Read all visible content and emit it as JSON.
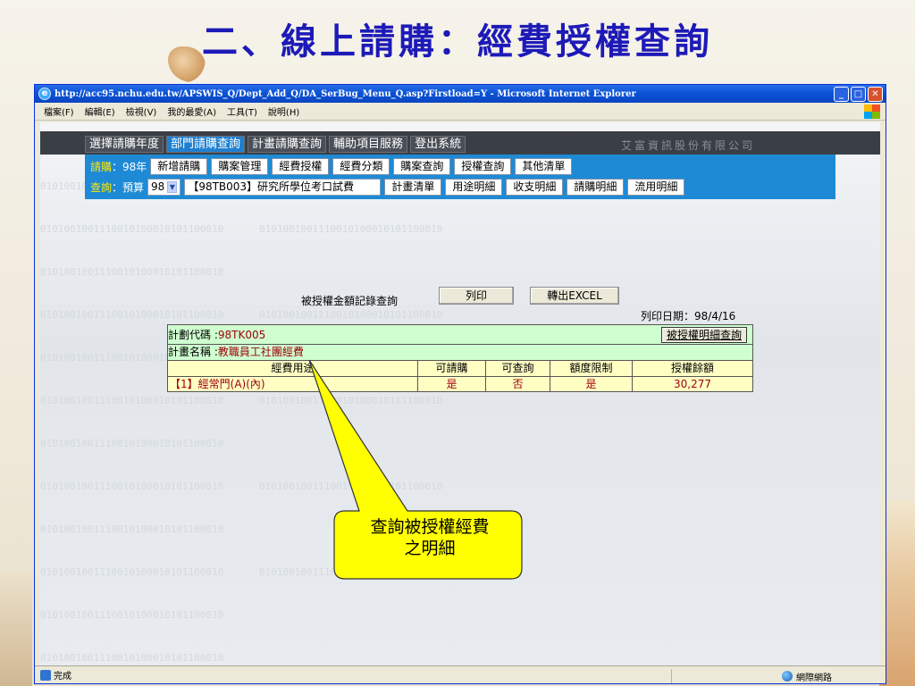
{
  "slide": {
    "title": "二、線上請購：經費授權查詢"
  },
  "browser": {
    "title": "http://acc95.nchu.edu.tw/APSWIS_Q/Dept_Add_Q/DA_SerBug_Menu_Q.asp?Firstload=Y - Microsoft Internet Explorer",
    "menu": [
      "檔案(F)",
      "編輯(E)",
      "檢視(V)",
      "我的最愛(A)",
      "工具(T)",
      "說明(H)"
    ],
    "status_text": "完成",
    "zone_text": "網際網路"
  },
  "nav": {
    "company": "艾富資訊股份有限公司",
    "tabs": [
      "選擇請購年度",
      "部門請購查詢",
      "計畫請購查詢",
      "輔助項目服務",
      "登出系統"
    ],
    "active_tab": 1,
    "row2_label_prefix": "請購",
    "row2_label_year": "：98年",
    "row2_buttons": [
      "新增請購",
      "購案管理",
      "經費授權",
      "經費分類",
      "購案查詢",
      "授權查詢",
      "其他清單"
    ],
    "row3_label_prefix": "查詢",
    "row3_label_rest": "：預算",
    "year_select": "98",
    "project_text": "【98TB003】研究所學位考口試費",
    "row3_buttons": [
      "計畫清單",
      "用途明細",
      "收支明細",
      "請購明細",
      "流用明細"
    ]
  },
  "query": {
    "title": "被授權金額記錄查詢",
    "print_label": "列印",
    "excel_label": "轉出EXCEL",
    "print_date": "列印日期：98/4/16",
    "plan_code_label": "計劃代碼 : ",
    "plan_code": "98TK005",
    "detail_button": "被授權明細查詢",
    "plan_name_label": "計畫名稱 : ",
    "plan_name": "教職員工社團經費",
    "columns": [
      "經費用途",
      "可請購",
      "可查詢",
      "額度限制",
      "授權餘額"
    ],
    "rows": [
      [
        "【1】經常門(A)(內)",
        "是",
        "否",
        "是",
        "30,277"
      ]
    ]
  },
  "callout": {
    "line1": "查詢被授權經費",
    "line2": "之明細"
  },
  "colors": {
    "slide_title": "#1d1ab8",
    "nav_blue": "#1e8ad6",
    "callout_fill": "#ffff00",
    "grid_green": "#cfffd0",
    "grid_yellow": "#ffffc4",
    "value_red": "#a0000c"
  }
}
